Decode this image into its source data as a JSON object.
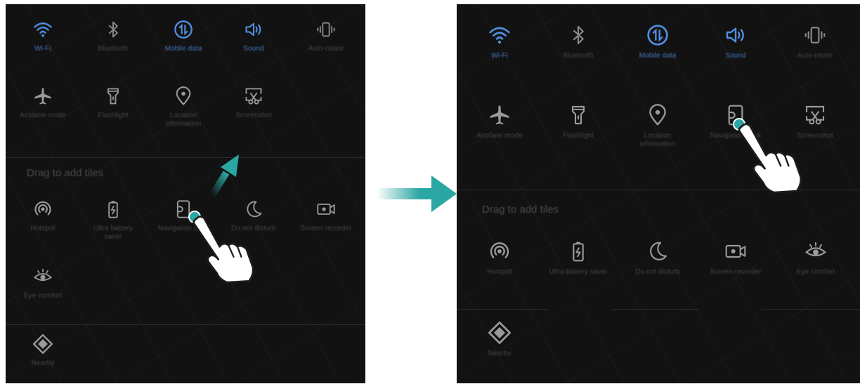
{
  "left_screen": {
    "active_tiles": [
      {
        "icon": "wifi-icon",
        "label": "Wi-Fi"
      },
      {
        "icon": "bluetooth-icon",
        "label": "Bluetooth"
      },
      {
        "icon": "mobile-data-icon",
        "label": "Mobile data"
      },
      {
        "icon": "sound-icon",
        "label": "Sound"
      },
      {
        "icon": "auto-rotate-icon",
        "label": "Auto-rotate"
      },
      {
        "icon": "airplane-icon",
        "label": "Airplane mode"
      },
      {
        "icon": "flashlight-icon",
        "label": "Flashlight"
      },
      {
        "icon": "location-icon",
        "label": "Location information"
      },
      {
        "icon": "screenshot-icon",
        "label": "Screenshot"
      }
    ],
    "section_title": "Drag to add tiles",
    "available_tiles": [
      {
        "icon": "hotspot-icon",
        "label": "Hotspot"
      },
      {
        "icon": "battery-saver-icon",
        "label": "Ultra battery saver"
      },
      {
        "icon": "navigation-dock-icon",
        "label": "Navigation dock"
      },
      {
        "icon": "moon-icon",
        "label": "Do not disturb"
      },
      {
        "icon": "screen-recorder-icon",
        "label": "Screen recorder"
      },
      {
        "icon": "eye-icon",
        "label": "Eye comfort"
      }
    ],
    "extra_tile": {
      "icon": "nearby-icon",
      "label": "Nearby"
    }
  },
  "right_screen": {
    "active_tiles": [
      {
        "icon": "wifi-icon",
        "label": "Wi-Fi"
      },
      {
        "icon": "bluetooth-icon",
        "label": "Bluetooth"
      },
      {
        "icon": "mobile-data-icon",
        "label": "Mobile data"
      },
      {
        "icon": "sound-icon",
        "label": "Sound"
      },
      {
        "icon": "auto-rotate-icon",
        "label": "Auto-rotate"
      },
      {
        "icon": "airplane-icon",
        "label": "Airplane mode"
      },
      {
        "icon": "flashlight-icon",
        "label": "Flashlight"
      },
      {
        "icon": "location-icon",
        "label": "Location information"
      },
      {
        "icon": "navigation-dock-icon",
        "label": "Navigation dock"
      },
      {
        "icon": "screenshot-icon",
        "label": "Screenshot"
      }
    ],
    "section_title": "Drag to add tiles",
    "available_tiles": [
      {
        "icon": "hotspot-icon",
        "label": "Hotspot"
      },
      {
        "icon": "battery-saver-icon",
        "label": "Ultra battery saver"
      },
      {
        "icon": "moon-icon",
        "label": "Do not disturb"
      },
      {
        "icon": "screen-recorder-icon",
        "label": "Screen recorder"
      },
      {
        "icon": "eye-icon",
        "label": "Eye comfort"
      }
    ],
    "extra_tile": {
      "icon": "nearby-icon",
      "label": "Nearby"
    }
  },
  "colors": {
    "active_blue": "#4f8fe0",
    "teal_accent": "#2aa6a3",
    "icon_gray": "#8a8a8a",
    "screen_bg": "#121212"
  }
}
